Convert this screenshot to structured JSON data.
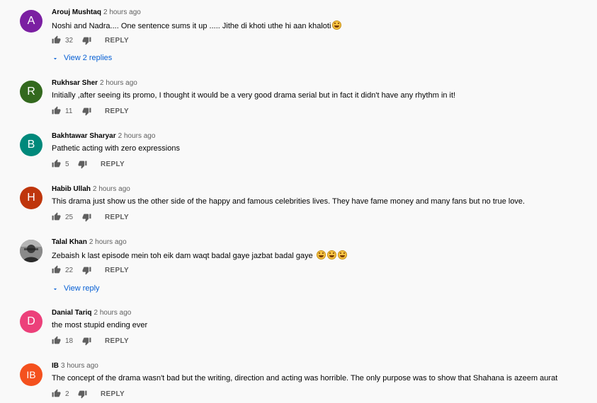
{
  "comments": [
    {
      "author": "Arouj Mushtaq",
      "time": "2 hours ago",
      "text": "Noshi and Nadra.... One sentence sums it up ..... Jithe di khoti uthe hi aan khaloti",
      "emoji_count": 1,
      "likes": "32",
      "reply_label": "REPLY",
      "avatar_letter": "A",
      "avatar_color": "#7b1fa2",
      "view_replies": "View 2 replies"
    },
    {
      "author": "Rukhsar Sher",
      "time": "2 hours ago",
      "text": "Initially ,after seeing its promo, I thought it would be a very good drama serial but in fact it didn't have any rhythm in it!",
      "emoji_count": 0,
      "likes": "11",
      "reply_label": "REPLY",
      "avatar_letter": "R",
      "avatar_color": "#33691e"
    },
    {
      "author": "Bakhtawar Sharyar",
      "time": "2 hours ago",
      "text": "Pathetic acting with zero expressions",
      "emoji_count": 0,
      "likes": "5",
      "reply_label": "REPLY",
      "avatar_letter": "B",
      "avatar_color": "#00897b"
    },
    {
      "author": "Habib Ullah",
      "time": "2 hours ago",
      "text": "This drama just show us the other side of the happy and famous celebrities lives. They have fame money and many fans but no true love.",
      "emoji_count": 0,
      "likes": "25",
      "reply_label": "REPLY",
      "avatar_letter": "H",
      "avatar_color": "#bf360c"
    },
    {
      "author": "Talal Khan",
      "time": "2 hours ago",
      "text": "Zebaish k last episode mein toh eik dam waqt badal gaye jazbat badal gaye",
      "emoji_count": 3,
      "likes": "22",
      "reply_label": "REPLY",
      "avatar_letter": "",
      "avatar_color": "#6d6d6d",
      "view_replies": "View reply"
    },
    {
      "author": "Danial Tariq",
      "time": "2 hours ago",
      "text": "the most stupid ending ever",
      "emoji_count": 0,
      "likes": "18",
      "reply_label": "REPLY",
      "avatar_letter": "D",
      "avatar_color": "#ec407a"
    },
    {
      "author": "IB",
      "time": "3 hours ago",
      "text": "The concept of the drama wasn't bad but the writing, direction and acting was horrible. The only purpose was to show that Shahana is azeem aurat",
      "emoji_count": 0,
      "likes": "2",
      "reply_label": "REPLY",
      "avatar_letter": "IB",
      "avatar_color": "#f4511e"
    }
  ],
  "icons": {
    "like": "thumbs-up-icon",
    "dislike": "thumbs-down-icon",
    "expand": "chevron-down-icon",
    "emoji": "tears-of-joy-emoji"
  },
  "colors": {
    "link": "#065fd4",
    "secondary_text": "#606060"
  }
}
